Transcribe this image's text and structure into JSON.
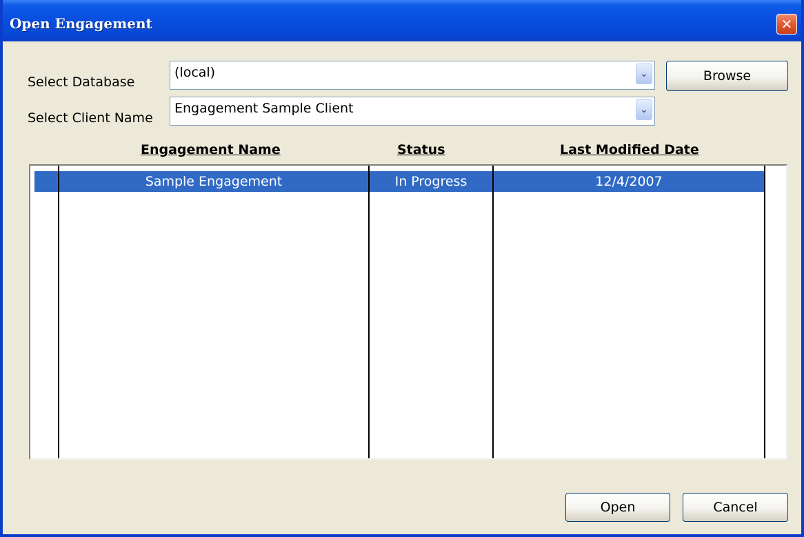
{
  "window": {
    "title": "Open Engagement",
    "close_glyph": "✕"
  },
  "database": {
    "label": "Select Database",
    "value": "(local)",
    "arrow_glyph": "⌄"
  },
  "client": {
    "label": "Select Client Name",
    "value": "Engagement Sample Client",
    "arrow_glyph": "⌄"
  },
  "browse": {
    "label": "Browse"
  },
  "table": {
    "columns": [
      "Engagement Name",
      "Status",
      "Last Modified Date"
    ],
    "rows": [
      {
        "name": "Sample Engagement",
        "status": "In Progress",
        "date": "12/4/2007",
        "selected": true
      }
    ]
  },
  "footer": {
    "open_label": "Open",
    "cancel_label": "Cancel"
  },
  "colors": {
    "titlebar": "#0A4FE0",
    "selection": "#316AC5",
    "dialog_bg": "#ECE9D8"
  }
}
